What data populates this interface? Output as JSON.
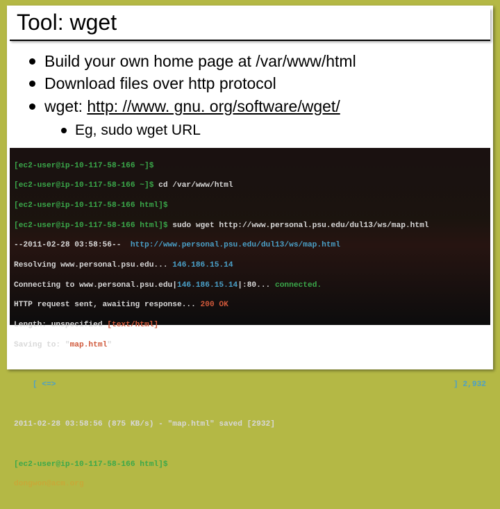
{
  "title": "Tool: wget",
  "bullets": {
    "b1": "Build your own home page at /var/www/html",
    "b2": "Download files over http protocol",
    "b3_pre": "wget: ",
    "b3_link": "http: //www. gnu. org/software/wget/",
    "sub1": "Eg, sudo wget URL"
  },
  "term": {
    "p1a": "[ec2-user@ip-10-117-58-166 ~]$",
    "p1b": "[ec2-user@ip-10-117-58-166 ~]$ ",
    "cmd1": "cd /var/www/html",
    "p2a": "[ec2-user@ip-10-117-58-166 html]$",
    "p2b": "[ec2-user@ip-10-117-58-166 html]$ ",
    "cmd2": "sudo wget http://www.personal.psu.edu/dul13/ws/map.html",
    "ts1": "--2011-02-28 03:58:56--  ",
    "url1": "http://www.personal.psu.edu/dul13/ws/map.html",
    "res_pre": "Resolving www.personal.psu.edu... ",
    "res_ip": "146.186.15.14",
    "con_pre": "Connecting to www.personal.psu.edu|",
    "con_ip": "146.186.15.14",
    "con_post": "|:80... ",
    "con_ok": "connected.",
    "req1": "HTTP request sent, awaiting response... ",
    "req_code": "200 OK",
    "len": "Length: unspecified ",
    "len_type": "[text/html]",
    "sav_pre": "Saving to: ",
    "sav_q1": "\"",
    "sav_file": "map.html",
    "sav_q2": "\"",
    "prog_l": "    [ <=>",
    "prog_r": "] 2,932",
    "done": "2011-02-28 03:58:56 (875 KB/s) - \"map.html\" saved [2932]",
    "p3": "[ec2-user@ip-10-117-58-166 html]$",
    "footer": "dongwon@acm.org"
  }
}
